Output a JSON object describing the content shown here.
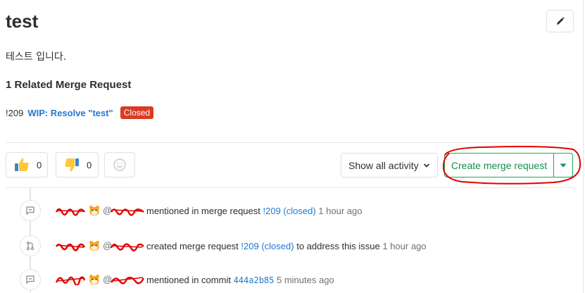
{
  "issue": {
    "title": "test",
    "description": "테스트 입니다."
  },
  "related": {
    "heading": "1 Related Merge Request",
    "mr_ref": "!209",
    "mr_title": "WIP: Resolve \"test\"",
    "mr_status": "Closed"
  },
  "awards": {
    "thumbsup_count": "0",
    "thumbsdown_count": "0"
  },
  "toolbar": {
    "activity_label": "Show all activity",
    "create_mr_label": "Create merge request"
  },
  "notes": [
    {
      "icon": "comment-icon",
      "action": "mentioned in merge request",
      "ref": "!209 (closed)",
      "time": "1 hour ago"
    },
    {
      "icon": "merge-request-icon",
      "action": "created merge request",
      "ref": "!209 (closed)",
      "suffix": "to address this issue",
      "time": "1 hour ago"
    },
    {
      "icon": "comment-icon",
      "action": "mentioned in commit",
      "ref": "444a2b85",
      "time": "5 minutes ago"
    }
  ],
  "colors": {
    "link": "#1f78d1",
    "closed_badge": "#db3b21",
    "create_mr": "#1aaa55",
    "annotation_red": "#e00000"
  }
}
